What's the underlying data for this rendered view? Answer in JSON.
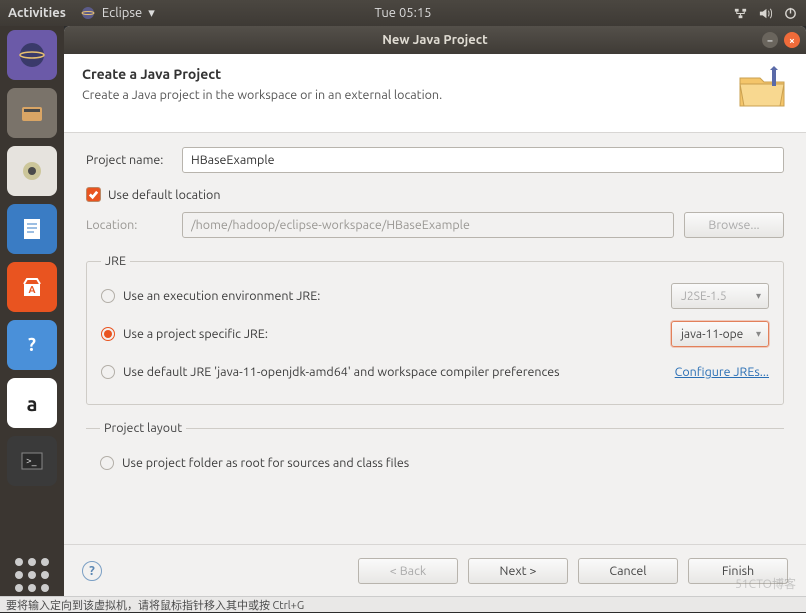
{
  "topbar": {
    "activities": "Activities",
    "app": "Eclipse",
    "clock": "Tue 05:15"
  },
  "window": {
    "title": "New Java Project"
  },
  "header": {
    "title": "Create a Java Project",
    "subtitle": "Create a Java project in the workspace or in an external location."
  },
  "project_name": {
    "label": "Project name:",
    "value": "HBaseExample"
  },
  "default_location": {
    "label": "Use default location",
    "checked": true
  },
  "location": {
    "label": "Location:",
    "value": "/home/hadoop/eclipse-workspace/HBaseExample",
    "browse": "Browse..."
  },
  "jre": {
    "legend": "JRE",
    "opt_env": "Use an execution environment JRE:",
    "env_value": "J2SE-1.5",
    "opt_specific": "Use a project specific JRE:",
    "specific_value": "java-11-ope",
    "opt_default": "Use default JRE 'java-11-openjdk-amd64' and workspace compiler preferences",
    "configure": "Configure JREs..."
  },
  "layout": {
    "legend": "Project layout",
    "opt_root": "Use project folder as root for sources and class files"
  },
  "footer": {
    "back": "< Back",
    "next": "Next >",
    "cancel": "Cancel",
    "finish": "Finish"
  },
  "bottombar": "要将输入定向到该虚拟机，请将鼠标指针移入其中或按 Ctrl+G",
  "watermark": "51CTO博客"
}
